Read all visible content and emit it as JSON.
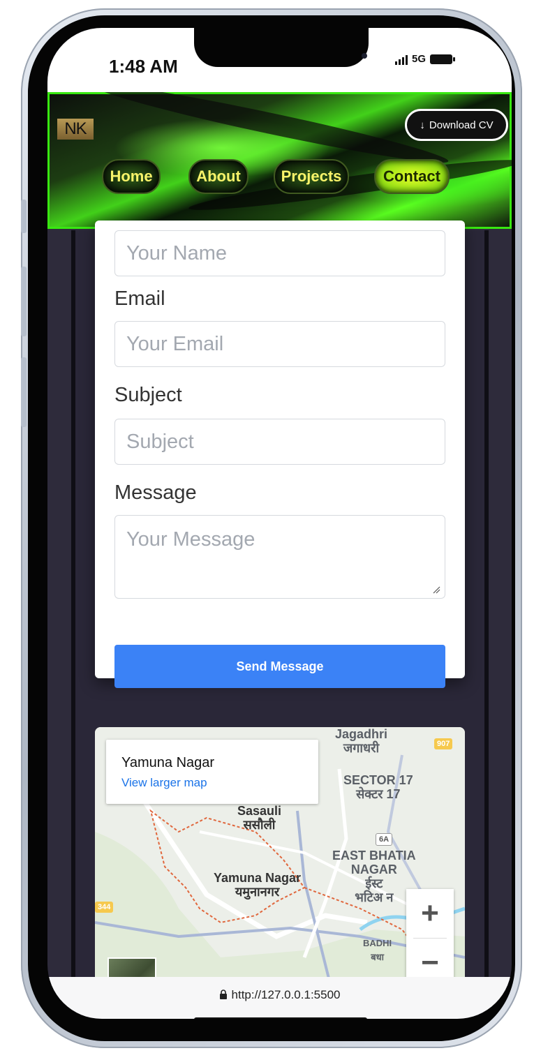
{
  "status_bar": {
    "time": "1:48 AM",
    "network": "5G"
  },
  "header": {
    "logo": "NK",
    "download_cv": "Download CV",
    "nav": [
      {
        "label": "Home",
        "active": false
      },
      {
        "label": "About",
        "active": false
      },
      {
        "label": "Projects",
        "active": false
      },
      {
        "label": "Contact",
        "active": true
      }
    ]
  },
  "form": {
    "name_placeholder": "Your Name",
    "email_label": "Email",
    "email_placeholder": "Your Email",
    "subject_label": "Subject",
    "subject_placeholder": "Subject",
    "message_label": "Message",
    "message_placeholder": "Your Message",
    "submit_label": "Send Message"
  },
  "map": {
    "place_title": "Yamuna Nagar",
    "larger_map_link": "View larger map",
    "labels": {
      "jagadhri": "Jagadhri",
      "jagadhri_hi": "जगाधरी",
      "sector17": "SECTOR 17",
      "sector17_hi": "सेक्टर 17",
      "sasauli": "Sasauli",
      "sasauli_hi": "ससौली",
      "east_bhatia": "EAST BHATIA",
      "nagar": "NAGAR",
      "east_hi": "ईस्ट",
      "bhatia_hi": "भटिअ न",
      "yamuna": "Yamuna Nagar",
      "yamuna_hi": "यमुनानगर",
      "badhi": "BADHI",
      "badhi_hi": "बधा"
    },
    "road_badges": {
      "r907": "907",
      "r6a": "6A",
      "r344": "344"
    },
    "zoom_in": "+",
    "zoom_out": "−"
  },
  "browser": {
    "url": "http://127.0.0.1:5500"
  },
  "colors": {
    "accent": "#3b82f6",
    "nav_active": "#e7ff2a",
    "header_glow": "#38e810",
    "background": "#2e2b3b"
  }
}
